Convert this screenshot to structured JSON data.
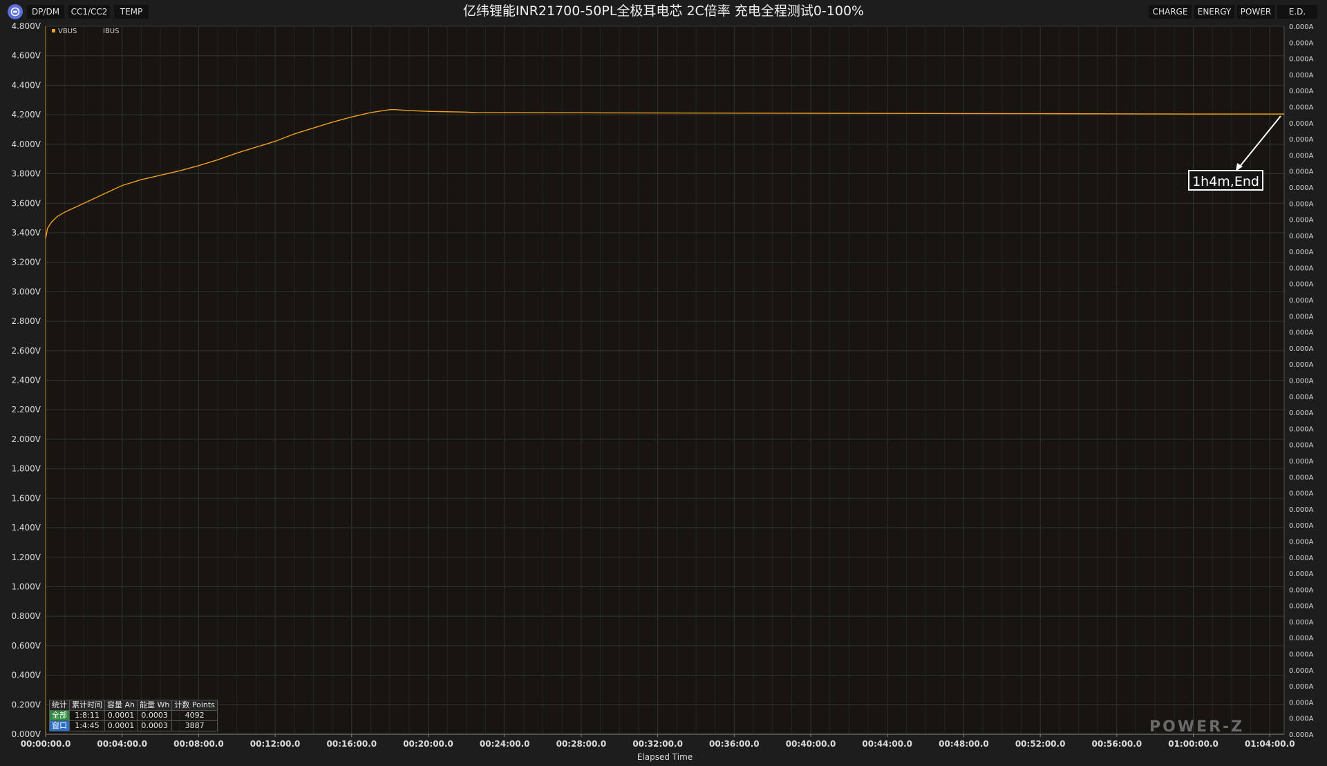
{
  "header": {
    "tabs_left": [
      "DP/DM",
      "CC1/CC2",
      "TEMP"
    ],
    "title": "亿纬锂能INR21700-50PL全极耳电芯 2C倍率 充电全程测试0-100%",
    "tabs_right": [
      "CHARGE",
      "ENERGY",
      "POWER",
      "E.D."
    ]
  },
  "legend": {
    "vbus": "VBUS",
    "ibus": "IBUS"
  },
  "colors": {
    "vbus": "#f0a020",
    "ibus": "#ffffff",
    "background": "#1d1d1d",
    "plot_bg": "#181410",
    "grid": "#2e2e2e"
  },
  "annotation": {
    "text": "1h4m,End"
  },
  "watermark": "POWER-Z",
  "stats": {
    "headers": [
      "统计",
      "累计时间",
      "容量 Ah",
      "能量 Wh",
      "计数 Points"
    ],
    "rows": [
      [
        "全部",
        "1:8:11",
        "0.0001",
        "0.0003",
        "4092"
      ],
      [
        "窗口",
        "1:4:45",
        "0.0001",
        "0.0003",
        "3887"
      ]
    ]
  },
  "chart_data": {
    "type": "line",
    "xlabel": "Elapsed Time",
    "ylabel": "",
    "x_unit": "minutes",
    "x_ticks": [
      "00:00:00.0",
      "00:04:00.0",
      "00:08:00.0",
      "00:12:00.0",
      "00:16:00.0",
      "00:20:00.0",
      "00:24:00.0",
      "00:28:00.0",
      "00:32:00.0",
      "00:36:00.0",
      "00:40:00.0",
      "00:44:00.0",
      "00:48:00.0",
      "00:52:00.0",
      "00:56:00.0",
      "01:00:00.0",
      "01:04:00.0"
    ],
    "xlim": [
      0,
      64.75
    ],
    "y_left_ticks": [
      "0.000V",
      "0.200V",
      "0.400V",
      "0.600V",
      "0.800V",
      "1.000V",
      "1.200V",
      "1.400V",
      "1.600V",
      "1.800V",
      "2.000V",
      "2.200V",
      "2.400V",
      "2.600V",
      "2.800V",
      "3.000V",
      "3.200V",
      "3.400V",
      "3.600V",
      "3.800V",
      "4.000V",
      "4.200V",
      "4.400V",
      "4.600V",
      "4.800V"
    ],
    "ylim_left": [
      0,
      4.8
    ],
    "y_right_tick_label": "0.000A",
    "y_right_tick_count": 45,
    "grid": true,
    "legend_position": "top-left",
    "series": [
      {
        "name": "VBUS",
        "axis": "left",
        "x": [
          0,
          0.1,
          0.3,
          0.6,
          1.0,
          1.5,
          2.0,
          3.0,
          4.0,
          5.0,
          6.0,
          7.0,
          8.0,
          9.0,
          10.0,
          11.0,
          12.0,
          13.0,
          14.0,
          15.0,
          16.0,
          17.0,
          18.0,
          18.3,
          19.0,
          20.0,
          22.0,
          22.5,
          24.0,
          28.0,
          32.0,
          36.0,
          40.0,
          44.0,
          48.0,
          52.0,
          56.0,
          60.0,
          64.75
        ],
        "y": [
          3.36,
          3.43,
          3.47,
          3.51,
          3.54,
          3.57,
          3.6,
          3.66,
          3.72,
          3.76,
          3.79,
          3.82,
          3.855,
          3.895,
          3.94,
          3.98,
          4.02,
          4.07,
          4.11,
          4.15,
          4.185,
          4.215,
          4.235,
          4.235,
          4.228,
          4.223,
          4.218,
          4.215,
          4.214,
          4.213,
          4.212,
          4.211,
          4.21,
          4.209,
          4.208,
          4.207,
          4.206,
          4.205,
          4.205
        ]
      },
      {
        "name": "IBUS",
        "axis": "right",
        "x": [
          0,
          64.75
        ],
        "y": [
          0,
          0
        ]
      }
    ]
  }
}
